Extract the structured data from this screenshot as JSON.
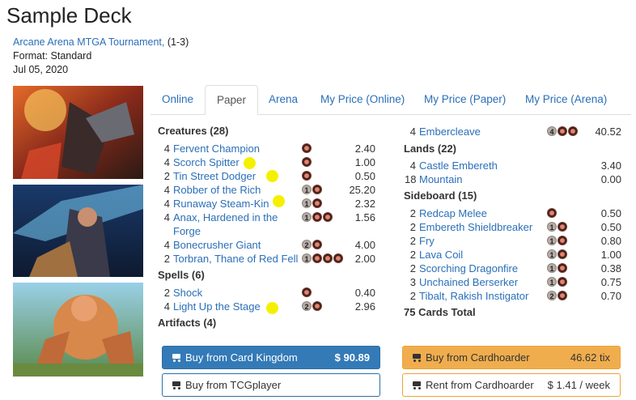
{
  "deck": {
    "title": "Sample Deck",
    "event_link": "Arcane Arena MTGA Tournament,",
    "record": "(1-3)",
    "format": "Format: Standard",
    "date": "Jul 05, 2020"
  },
  "tabs": [
    "Online",
    "Paper",
    "Arena",
    "My Price (Online)",
    "My Price (Paper)",
    "My Price (Arena)"
  ],
  "active_tab": "Paper",
  "sections": {
    "creatures": {
      "header": "Creatures (28)",
      "cards": [
        {
          "qty": "4",
          "name": "Fervent Champion",
          "mana": [
            "R"
          ],
          "price": "2.40"
        },
        {
          "qty": "4",
          "name": "Scorch Spitter",
          "mana": [
            "R"
          ],
          "price": "1.00"
        },
        {
          "qty": "2",
          "name": "Tin Street Dodger",
          "mana": [
            "R"
          ],
          "price": "0.50"
        },
        {
          "qty": "4",
          "name": "Robber of the Rich",
          "mana": [
            "1",
            "R"
          ],
          "price": "25.20"
        },
        {
          "qty": "4",
          "name": "Runaway Steam-Kin",
          "mana": [
            "1",
            "R"
          ],
          "price": "2.32"
        },
        {
          "qty": "4",
          "name": "Anax, Hardened in the",
          "name2": "Forge",
          "mana": [
            "1",
            "R",
            "R"
          ],
          "price": "1.56"
        },
        {
          "qty": "4",
          "name": "Bonecrusher Giant",
          "mana": [
            "2",
            "R"
          ],
          "price": "4.00"
        },
        {
          "qty": "2",
          "name": "Torbran, Thane of Red Fell",
          "mana": [
            "1",
            "R",
            "R",
            "R"
          ],
          "price": "2.00"
        }
      ]
    },
    "spells": {
      "header": "Spells (6)",
      "cards": [
        {
          "qty": "2",
          "name": "Shock",
          "mana": [
            "R"
          ],
          "price": "0.40"
        },
        {
          "qty": "4",
          "name": "Light Up the Stage",
          "mana": [
            "2",
            "R"
          ],
          "price": "2.96"
        }
      ]
    },
    "artifacts": {
      "header": "Artifacts (4)",
      "cards": [
        {
          "qty": "4",
          "name": "Embercleave",
          "mana": [
            "4",
            "R",
            "R"
          ],
          "price": "40.52"
        }
      ]
    },
    "lands": {
      "header": "Lands (22)",
      "cards": [
        {
          "qty": "4",
          "name": "Castle Embereth",
          "mana": [],
          "price": "3.40"
        },
        {
          "qty": "18",
          "name": "Mountain",
          "mana": [],
          "price": "0.00"
        }
      ]
    },
    "sideboard": {
      "header": "Sideboard (15)",
      "cards": [
        {
          "qty": "2",
          "name": "Redcap Melee",
          "mana": [
            "R"
          ],
          "price": "0.50"
        },
        {
          "qty": "2",
          "name": "Embereth Shieldbreaker",
          "mana": [
            "1",
            "R"
          ],
          "price": "0.50"
        },
        {
          "qty": "2",
          "name": "Fry",
          "mana": [
            "1",
            "R"
          ],
          "price": "0.80"
        },
        {
          "qty": "2",
          "name": "Lava Coil",
          "mana": [
            "1",
            "R"
          ],
          "price": "1.00"
        },
        {
          "qty": "2",
          "name": "Scorching Dragonfire",
          "mana": [
            "1",
            "R"
          ],
          "price": "0.38"
        },
        {
          "qty": "3",
          "name": "Unchained Berserker",
          "mana": [
            "1",
            "R"
          ],
          "price": "0.75"
        },
        {
          "qty": "2",
          "name": "Tibalt, Rakish Instigator",
          "mana": [
            "2",
            "R"
          ],
          "price": "0.70"
        }
      ]
    }
  },
  "total": "75 Cards Total",
  "buttons": {
    "card_kingdom": {
      "label": "Buy from Card Kingdom",
      "amount": "$ 90.89"
    },
    "cardhoarder": {
      "label": "Buy from Cardhoarder",
      "amount": "46.62 tix"
    },
    "tcgplayer": {
      "label": "Buy from TCGplayer"
    },
    "rent": {
      "label": "Rent from Cardhoarder",
      "amount": "$ 1.41 / week"
    }
  },
  "colors": {
    "link": "#2a6fb8",
    "primary": "#337ab7",
    "warning": "#f0ad4e",
    "highlight_dot": "#f5f000"
  }
}
